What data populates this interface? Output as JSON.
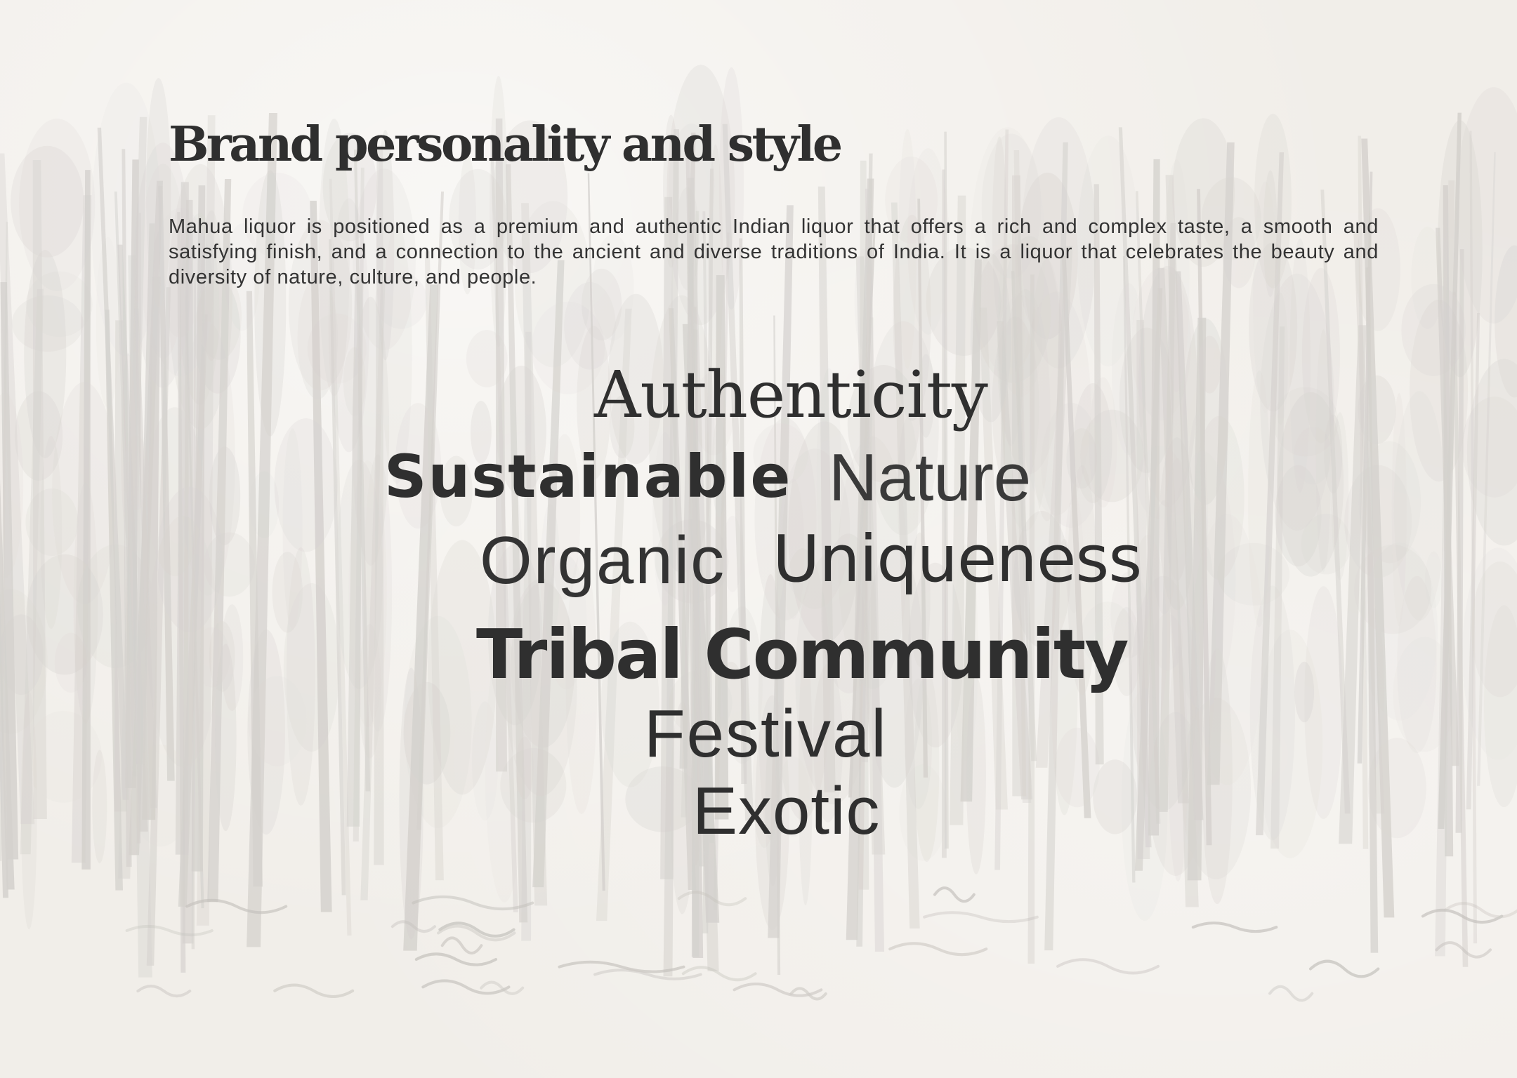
{
  "page": {
    "title": "Brand personality and style",
    "intro": "Mahua liquor is positioned as a premium and authentic Indian liquor that offers a rich and complex taste, a smooth and satisfying finish, and a connection to the ancient and diverse traditions of India. It is a liquor that celebrates the beauty and diversity of nature, culture, and people."
  },
  "keywords": {
    "authenticity": "Authenticity",
    "sustainable": "Sustainable",
    "nature": "Nature",
    "organic": "Organic",
    "uniqueness": "Uniqueness",
    "tribal_community": "Tribal Community",
    "festival": "Festival",
    "exotic": "Exotic"
  },
  "colors": {
    "background": "#f1eee9",
    "text": "#2f2f2f",
    "forest_tone": "#c9c6c2"
  },
  "background_art": "forest-sketch-illustration"
}
